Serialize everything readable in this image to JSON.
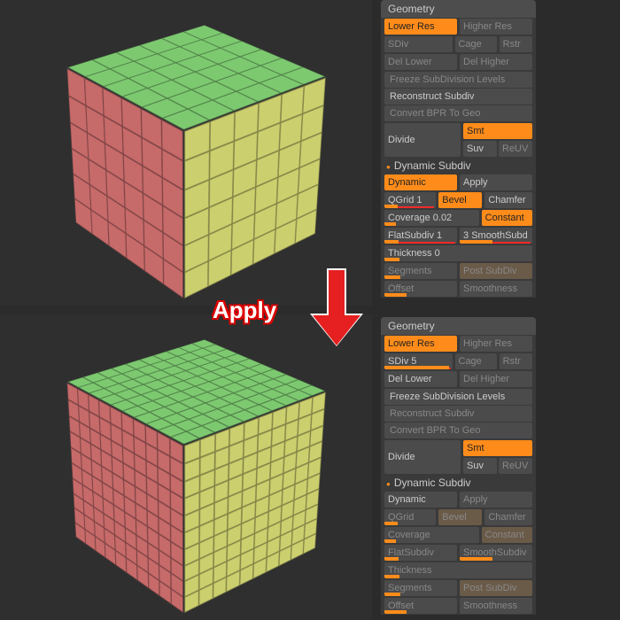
{
  "overlay": {
    "apply": "Apply"
  },
  "panel_top": {
    "title": "Geometry",
    "lower_res": "Lower Res",
    "higher_res": "Higher Res",
    "sdiv": "SDiv",
    "cage": "Cage",
    "rstr": "Rstr",
    "del_lower": "Del Lower",
    "del_higher": "Del Higher",
    "freeze": "Freeze SubDivision Levels",
    "reconstruct": "Reconstruct Subdiv",
    "convert": "Convert BPR To Geo",
    "divide": "Divide",
    "smt": "Smt",
    "suv": "Suv",
    "reuv": "ReUV",
    "dyn_header": "Dynamic Subdiv",
    "dynamic": "Dynamic",
    "apply": "Apply",
    "qgrid": "QGrid",
    "qgrid_val": "1",
    "bevel": "Bevel",
    "chamfer": "Chamfer",
    "coverage": "Coverage",
    "coverage_val": "0.02",
    "constant": "Constant",
    "flat": "FlatSubdiv",
    "flat_val": "1",
    "smooth": "SmoothSubd",
    "smooth_val": "3",
    "thickness": "Thickness",
    "thickness_val": "0",
    "segments": "Segments",
    "postsub": "Post SubDiv",
    "offset": "Offset",
    "smoothness": "Smoothness"
  },
  "panel_bottom": {
    "title": "Geometry",
    "lower_res": "Lower Res",
    "higher_res": "Higher Res",
    "sdiv": "SDiv",
    "sdiv_val": "5",
    "cage": "Cage",
    "rstr": "Rstr",
    "del_lower": "Del Lower",
    "del_higher": "Del Higher",
    "freeze": "Freeze SubDivision Levels",
    "reconstruct": "Reconstruct Subdiv",
    "convert": "Convert BPR To Geo",
    "divide": "Divide",
    "smt": "Smt",
    "suv": "Suv",
    "reuv": "ReUV",
    "dyn_header": "Dynamic Subdiv",
    "dynamic": "Dynamic",
    "apply": "Apply",
    "qgrid": "QGrid",
    "bevel": "Bevel",
    "chamfer": "Chamfer",
    "coverage": "Coverage",
    "constant": "Constant",
    "flat": "FlatSubdiv",
    "smooth": "SmoothSubdiv",
    "thickness": "Thickness",
    "segments": "Segments",
    "postsub": "Post SubDiv",
    "offset": "Offset",
    "smoothness": "Smoothness"
  }
}
